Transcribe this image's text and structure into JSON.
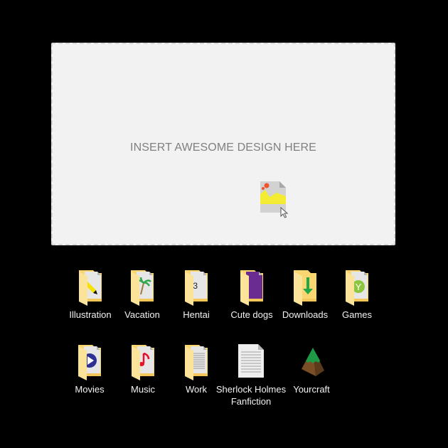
{
  "dropzone": {
    "placeholder_text": "INSERT AWESOME DESIGN HERE",
    "dragged_item_icon": "image-file-icon",
    "cursor_icon": "arrow-cursor-icon"
  },
  "icons": [
    {
      "label": "Illustration",
      "icon": "folder-pencil-icon"
    },
    {
      "label": "Vacation",
      "icon": "folder-palm-tree-icon"
    },
    {
      "label": "Hentai",
      "icon": "folder-text-face-icon",
      "glyph": ":3"
    },
    {
      "label": "Cute dogs",
      "icon": "folder-purple-file-icon"
    },
    {
      "label": "Downloads",
      "icon": "folder-download-arrow-icon"
    },
    {
      "label": "Games",
      "icon": "folder-games-icon",
      "glyph": "Y"
    },
    {
      "label": "Movies",
      "icon": "folder-play-icon"
    },
    {
      "label": "Music",
      "icon": "folder-music-note-icon"
    },
    {
      "label": "Work",
      "icon": "folder-document-icon"
    },
    {
      "label": "Sherlock Holmes Fanfiction",
      "label_line1": "Sherlock Holmes",
      "label_line2": "Fanfiction",
      "icon": "text-document-icon"
    },
    {
      "label": "Yourcraft",
      "icon": "pyramid-app-icon"
    }
  ],
  "colors": {
    "background": "#000000",
    "dropzone_bg": "#f2f2f2",
    "folder_yellow": "#f9d66f",
    "folder_light": "#fbe49a"
  }
}
